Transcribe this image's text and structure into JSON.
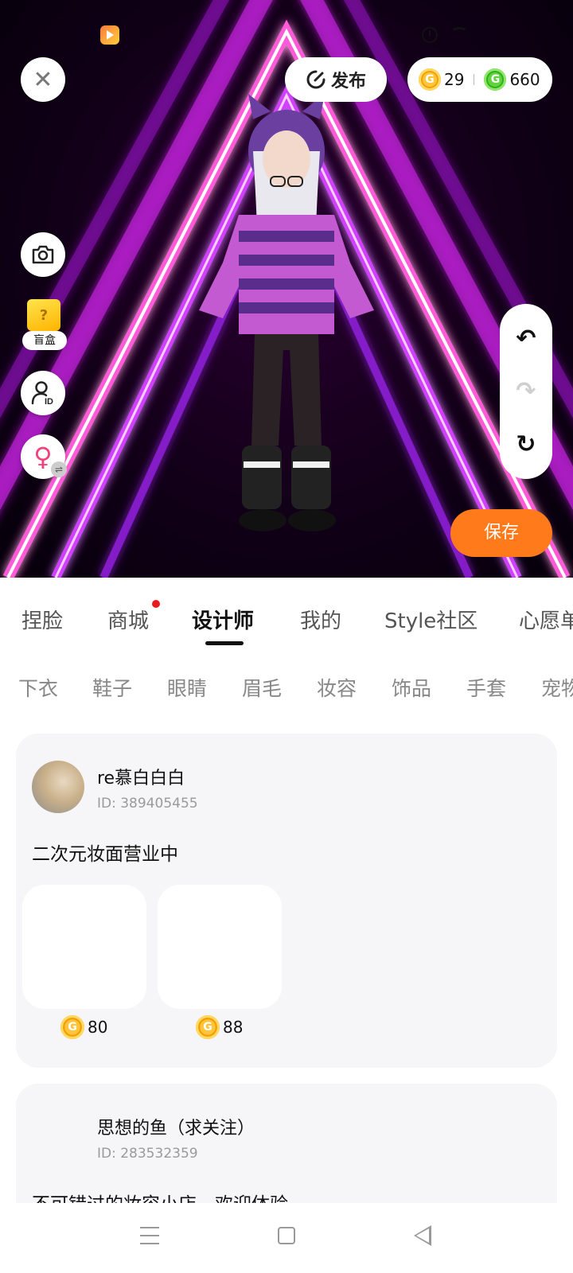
{
  "header": {
    "close_icon": "close-icon",
    "publish_label": "发布",
    "wallet": {
      "gold_coins": "29",
      "green_coins": "660"
    }
  },
  "side_tools": {
    "blindbox_label": "盲盒",
    "blindbox_symbol": "?"
  },
  "actions": {
    "save_label": "保存"
  },
  "main_tabs": [
    {
      "label": "捏脸"
    },
    {
      "label": "商城",
      "badge": true
    },
    {
      "label": "设计师",
      "active": true
    },
    {
      "label": "我的"
    },
    {
      "label": "Style社区"
    },
    {
      "label": "心愿单"
    }
  ],
  "sub_tabs": [
    {
      "label": "下衣"
    },
    {
      "label": "鞋子"
    },
    {
      "label": "眼睛"
    },
    {
      "label": "眉毛"
    },
    {
      "label": "妆容"
    },
    {
      "label": "饰品"
    },
    {
      "label": "手套"
    },
    {
      "label": "宠物"
    }
  ],
  "designers": [
    {
      "name": "re慕白白白",
      "id": "ID: 389405455",
      "bio": "二次元妆面营业中",
      "items": [
        {
          "price": "80"
        },
        {
          "price": "88"
        }
      ]
    },
    {
      "name": "思想的鱼（求关注）",
      "id": "ID: 283532359",
      "bio": "不可错过的妆容小店，欢迎体验"
    }
  ],
  "colors": {
    "accent_orange": "#ff7a1a",
    "gold_coin": "#f2a100",
    "green_coin": "#2fae1e",
    "badge_red": "#e81c1c"
  }
}
